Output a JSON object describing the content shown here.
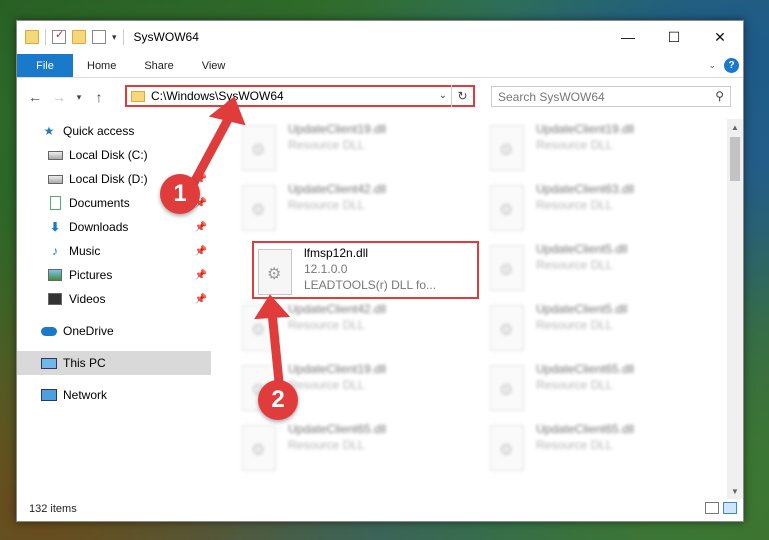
{
  "window": {
    "title": "SysWOW64"
  },
  "window_controls": {
    "minimize": "—",
    "maximize": "☐",
    "close": "✕"
  },
  "ribbon": {
    "tabs": [
      "File",
      "Home",
      "Share",
      "View"
    ]
  },
  "address": {
    "path": "C:\\Windows\\SysWOW64"
  },
  "search": {
    "placeholder": "Search SysWOW64"
  },
  "sidebar": {
    "quick_access": "Quick access",
    "items": [
      {
        "label": "Local Disk (C:)",
        "icon": "drive-icon"
      },
      {
        "label": "Local Disk (D:)",
        "icon": "drive-icon"
      },
      {
        "label": "Documents",
        "icon": "documents-icon"
      },
      {
        "label": "Downloads",
        "icon": "downloads-icon"
      },
      {
        "label": "Music",
        "icon": "music-icon"
      },
      {
        "label": "Pictures",
        "icon": "pictures-icon"
      },
      {
        "label": "Videos",
        "icon": "videos-icon"
      }
    ],
    "onedrive": "OneDrive",
    "this_pc": "This PC",
    "network": "Network"
  },
  "files": {
    "left": [
      {
        "name": "UpdateClient19.dll",
        "sub": "Resource DLL"
      },
      {
        "name": "UpdateClient42.dll",
        "sub": "Resource DLL"
      },
      {
        "name": "UpdateClient42.dll",
        "sub": "Resource DLL"
      },
      {
        "name": "UpdateClient19.dll",
        "sub": "Resource DLL"
      },
      {
        "name": "UpdateClient65.dll",
        "sub": "Resource DLL"
      }
    ],
    "highlighted": {
      "name": "lfmsp12n.dll",
      "version": "12.1.0.0",
      "desc": "LEADTOOLS(r) DLL fo..."
    },
    "right": [
      {
        "name": "UpdateClient19.dll",
        "sub": "Resource DLL"
      },
      {
        "name": "UpdateClient63.dll",
        "sub": "Resource DLL"
      },
      {
        "name": "UpdateClient5.dll",
        "sub": "Resource DLL"
      },
      {
        "name": "UpdateClient5.dll",
        "sub": "Resource DLL"
      },
      {
        "name": "UpdateClient65.dll",
        "sub": "Resource DLL"
      },
      {
        "name": "UpdateClient65.dll",
        "sub": "Resource DLL"
      }
    ]
  },
  "status": {
    "count": "132 items"
  },
  "annotations": {
    "step1": "1",
    "step2": "2",
    "color": "#e03c3c"
  }
}
